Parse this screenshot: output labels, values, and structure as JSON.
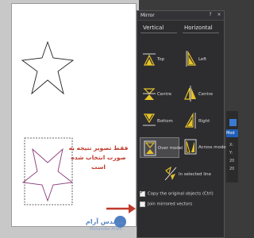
{
  "annotation": {
    "line1": "فقط تصویر نتیجه به",
    "line2": "صورت انتخاب شده است"
  },
  "logo": {
    "name": "مهندس آرام",
    "sub": "Mohandes Aram"
  },
  "panel": {
    "title": "Mirror",
    "help": "?",
    "close": "×",
    "columns": {
      "vertical": "Vertical",
      "horizontal": "Horizontal"
    },
    "vertical_options": [
      {
        "label": "Top",
        "icon": "mirror-top-icon"
      },
      {
        "label": "Centre",
        "icon": "mirror-centre-icon"
      },
      {
        "label": "Bottom",
        "icon": "mirror-bottom-icon"
      },
      {
        "label": "Over model",
        "icon": "mirror-over-model-icon",
        "selected": true
      }
    ],
    "horizontal_options": [
      {
        "label": "Left",
        "icon": "mirror-left-icon"
      },
      {
        "label": "Centre",
        "icon": "mirror-centre-h-icon"
      },
      {
        "label": "Right",
        "icon": "mirror-right-icon"
      },
      {
        "label": "Across model",
        "icon": "mirror-across-model-icon"
      }
    ],
    "selected_line_label": "In selected line",
    "copy_label": "Copy the original objects (Ctrl)",
    "copy_checked": true,
    "join_label": "Join mirrored vectors",
    "join_checked": false
  },
  "edge": {
    "tab": "Mod",
    "line1": "X:",
    "line2": "Y:",
    "line3": "20",
    "line4": "20"
  },
  "colors": {
    "accent": "#e6c229",
    "arrow": "#c0392b",
    "star": "#8a3a7a"
  }
}
